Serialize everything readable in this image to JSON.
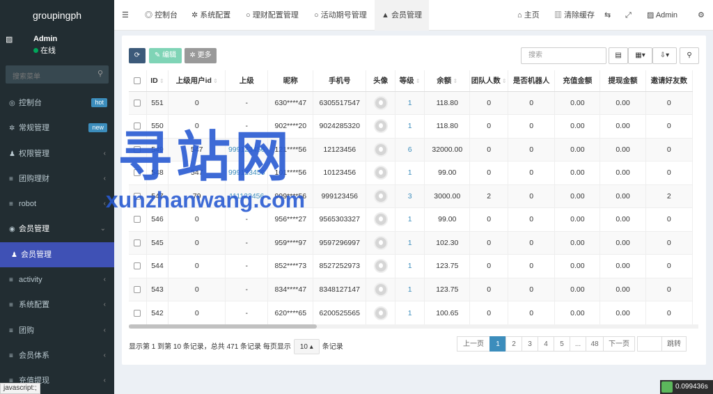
{
  "brand": "groupingph",
  "user": {
    "name": "Admin",
    "status": "在线"
  },
  "sidebar": {
    "search_placeholder": "搜索菜单",
    "items": [
      {
        "label": "控制台",
        "icon": "dashboard-icon",
        "badge": "hot",
        "badge_color": "#3c8dbc"
      },
      {
        "label": "常规管理",
        "icon": "cogs-icon",
        "badge": "new",
        "badge_color": "#3c8dbc"
      },
      {
        "label": "权限管理",
        "icon": "group-icon"
      },
      {
        "label": "团购理财",
        "icon": "list-icon"
      },
      {
        "label": "robot",
        "icon": "list-icon"
      },
      {
        "label": "会员管理",
        "icon": "user-circle-icon"
      },
      {
        "label": "会员管理",
        "icon": "user-icon"
      },
      {
        "label": "activity",
        "icon": "list-icon"
      },
      {
        "label": "系统配置",
        "icon": "list-icon"
      },
      {
        "label": "团购",
        "icon": "list-icon"
      },
      {
        "label": "会员体系",
        "icon": "list-icon"
      },
      {
        "label": "充值提现",
        "icon": "list-icon"
      }
    ]
  },
  "topbar": {
    "tabs": [
      "控制台",
      "系统配置",
      "理财配置管理",
      "活动期号管理",
      "会员管理"
    ],
    "home": "主页",
    "clear_cache": "清除缓存",
    "admin": "Admin"
  },
  "toolbar": {
    "edit": "编辑",
    "more": "更多",
    "search_placeholder": "搜索"
  },
  "table": {
    "headers": [
      "ID",
      "上级用户id",
      "上级",
      "昵称",
      "手机号",
      "头像",
      "等级",
      "余额",
      "团队人数",
      "是否机器人",
      "充值金额",
      "提现金额",
      "邀请好友数"
    ],
    "rows": [
      [
        "551",
        "0",
        "-",
        "630****47",
        "6305517547",
        "1",
        "118.80",
        "0",
        "0",
        "0.00",
        "0.00",
        "0"
      ],
      [
        "550",
        "0",
        "-",
        "902****20",
        "9024285320",
        "1",
        "118.80",
        "0",
        "0",
        "0.00",
        "0.00",
        "0"
      ],
      [
        "549",
        "547",
        "999123456",
        "121****56",
        "12123456",
        "6",
        "32000.00",
        "0",
        "0",
        "0.00",
        "0.00",
        "0"
      ],
      [
        "548",
        "547",
        "999123456",
        "101****56",
        "10123456",
        "1",
        "99.00",
        "0",
        "0",
        "0.00",
        "0.00",
        "0"
      ],
      [
        "547",
        "79",
        "111123456",
        "999****56",
        "999123456",
        "3",
        "3000.00",
        "2",
        "0",
        "0.00",
        "0.00",
        "2"
      ],
      [
        "546",
        "0",
        "-",
        "956****27",
        "9565303327",
        "1",
        "99.00",
        "0",
        "0",
        "0.00",
        "0.00",
        "0"
      ],
      [
        "545",
        "0",
        "-",
        "959****97",
        "9597296997",
        "1",
        "102.30",
        "0",
        "0",
        "0.00",
        "0.00",
        "0"
      ],
      [
        "544",
        "0",
        "-",
        "852****73",
        "8527252973",
        "1",
        "123.75",
        "0",
        "0",
        "0.00",
        "0.00",
        "0"
      ],
      [
        "543",
        "0",
        "-",
        "834****47",
        "8348127147",
        "1",
        "123.75",
        "0",
        "0",
        "0.00",
        "0.00",
        "0"
      ],
      [
        "542",
        "0",
        "-",
        "620****65",
        "6200525565",
        "1",
        "100.65",
        "0",
        "0",
        "0.00",
        "0.00",
        "0"
      ]
    ]
  },
  "footer": {
    "info_prefix": "显示第 1 到第 10 条记录，总共 471 条记录 每页显示",
    "page_size": "10",
    "info_suffix": "条记录"
  },
  "pager": {
    "prev": "上一页",
    "pages": [
      "1",
      "2",
      "3",
      "4",
      "5",
      "...",
      "48"
    ],
    "next": "下一页",
    "jump": "跳转"
  },
  "watermark": {
    "big": "寻站网",
    "small": "xunzhanwang.com"
  },
  "statusbar": "javascript:;",
  "timer": "0.099436s"
}
